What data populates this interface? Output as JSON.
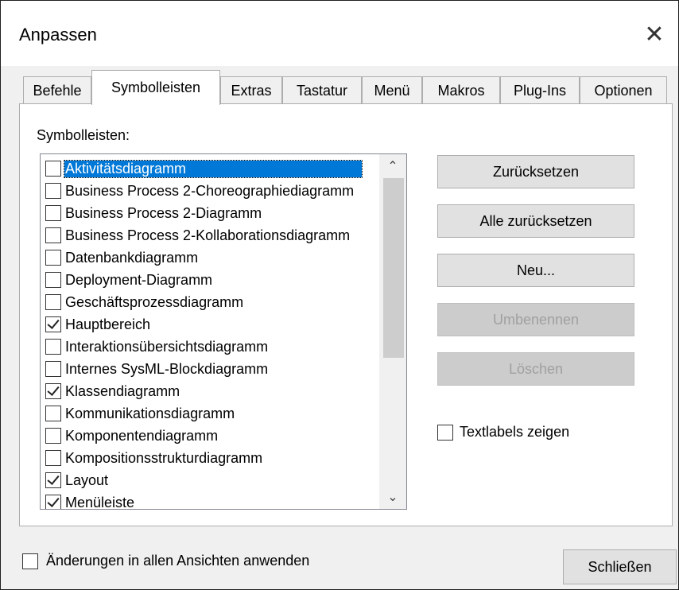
{
  "window": {
    "title": "Anpassen",
    "close_glyph": "✕"
  },
  "tabs": [
    {
      "label": "Befehle",
      "active": false
    },
    {
      "label": "Symbolleisten",
      "active": true
    },
    {
      "label": "Extras",
      "active": false
    },
    {
      "label": "Tastatur",
      "active": false
    },
    {
      "label": "Menü",
      "active": false
    },
    {
      "label": "Makros",
      "active": false
    },
    {
      "label": "Plug-Ins",
      "active": false
    },
    {
      "label": "Optionen",
      "active": false
    }
  ],
  "toolbars": {
    "label": "Symbolleisten:",
    "items": [
      {
        "label": "Aktivitätsdiagramm",
        "checked": false,
        "selected": true
      },
      {
        "label": "Business Process 2-Choreographiediagramm",
        "checked": false,
        "selected": false
      },
      {
        "label": "Business Process 2-Diagramm",
        "checked": false,
        "selected": false
      },
      {
        "label": "Business Process 2-Kollaborationsdiagramm",
        "checked": false,
        "selected": false
      },
      {
        "label": "Datenbankdiagramm",
        "checked": false,
        "selected": false
      },
      {
        "label": "Deployment-Diagramm",
        "checked": false,
        "selected": false
      },
      {
        "label": "Geschäftsprozessdiagramm",
        "checked": false,
        "selected": false
      },
      {
        "label": "Hauptbereich",
        "checked": true,
        "selected": false
      },
      {
        "label": "Interaktionsübersichtsdiagramm",
        "checked": false,
        "selected": false
      },
      {
        "label": "Internes SysML-Blockdiagramm",
        "checked": false,
        "selected": false
      },
      {
        "label": "Klassendiagramm",
        "checked": true,
        "selected": false
      },
      {
        "label": "Kommunikationsdiagramm",
        "checked": false,
        "selected": false
      },
      {
        "label": "Komponentendiagramm",
        "checked": false,
        "selected": false
      },
      {
        "label": "Kompositionsstrukturdiagramm",
        "checked": false,
        "selected": false
      },
      {
        "label": "Layout",
        "checked": true,
        "selected": false
      },
      {
        "label": "Menüleiste",
        "checked": true,
        "selected": false
      }
    ],
    "scroll_up_glyph": "⌃",
    "scroll_down_glyph": "⌄"
  },
  "buttons": {
    "reset": "Zurücksetzen",
    "reset_all": "Alle zurücksetzen",
    "new": "Neu...",
    "rename": "Umbenennen",
    "delete": "Löschen"
  },
  "options": {
    "show_text_labels": {
      "label": "Textlabels zeigen",
      "checked": false
    },
    "apply_all_views": {
      "label": "Änderungen in allen Ansichten anwenden",
      "checked": false
    }
  },
  "footer": {
    "close_label": "Schließen"
  }
}
